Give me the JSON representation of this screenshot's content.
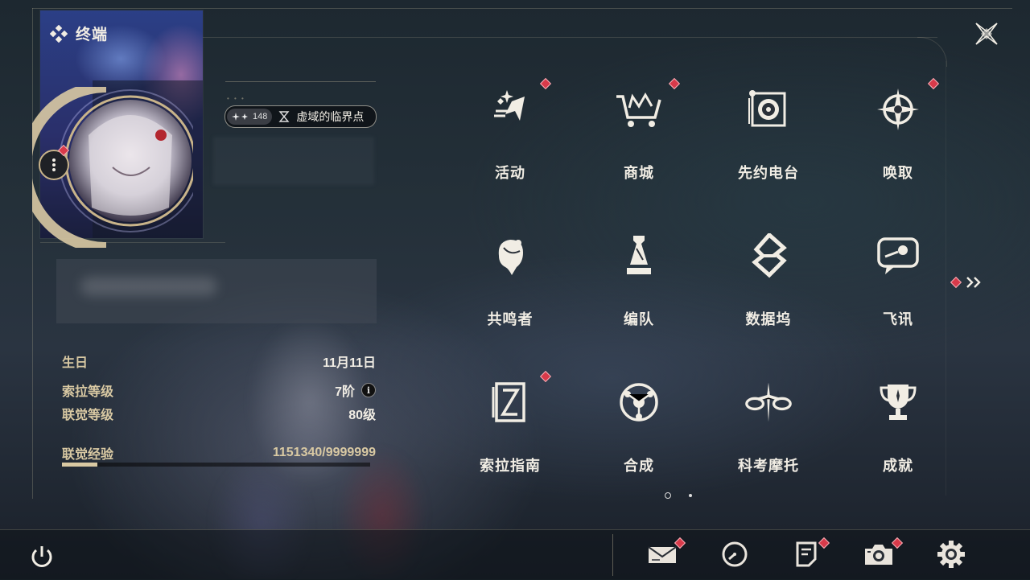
{
  "header": {
    "title": "终端"
  },
  "profile": {
    "level_badge": {
      "value": "148",
      "name": "虚域的临界点"
    },
    "info": [
      {
        "label": "生日",
        "value": "11月11日"
      },
      {
        "label": "索拉等级",
        "value": "7阶"
      },
      {
        "label": "联觉等级",
        "value": "80级"
      },
      {
        "label": "联觉经验",
        "value": "1151340/9999999"
      }
    ],
    "exp_progress": 0.115
  },
  "menu": {
    "items": [
      {
        "label": "活动",
        "icon": "activity-icon",
        "badge": true
      },
      {
        "label": "商城",
        "icon": "shop-cart-icon",
        "badge": true
      },
      {
        "label": "先约电台",
        "icon": "radio-icon",
        "badge": false
      },
      {
        "label": "唤取",
        "icon": "summon-compass-icon",
        "badge": true
      },
      {
        "label": "共鸣者",
        "icon": "resonator-head-icon",
        "badge": false
      },
      {
        "label": "编队",
        "icon": "chess-team-icon",
        "badge": false
      },
      {
        "label": "数据坞",
        "icon": "data-dock-icon",
        "badge": false
      },
      {
        "label": "飞讯",
        "icon": "message-bubble-icon",
        "badge": false
      },
      {
        "label": "索拉指南",
        "icon": "guide-book-icon",
        "badge": true
      },
      {
        "label": "合成",
        "icon": "synthesis-icon",
        "badge": false
      },
      {
        "label": "科考摩托",
        "icon": "motorbike-icon",
        "badge": false
      },
      {
        "label": "成就",
        "icon": "trophy-icon",
        "badge": false
      }
    ]
  },
  "bottom": {
    "buttons": [
      "power-icon",
      "mail-icon",
      "clock-icon",
      "notice-icon",
      "camera-icon",
      "settings-gear-icon"
    ]
  },
  "colors": {
    "accent": "#d9c9a3",
    "badge_red": "#d83a4a",
    "text": "#f1ede4"
  }
}
